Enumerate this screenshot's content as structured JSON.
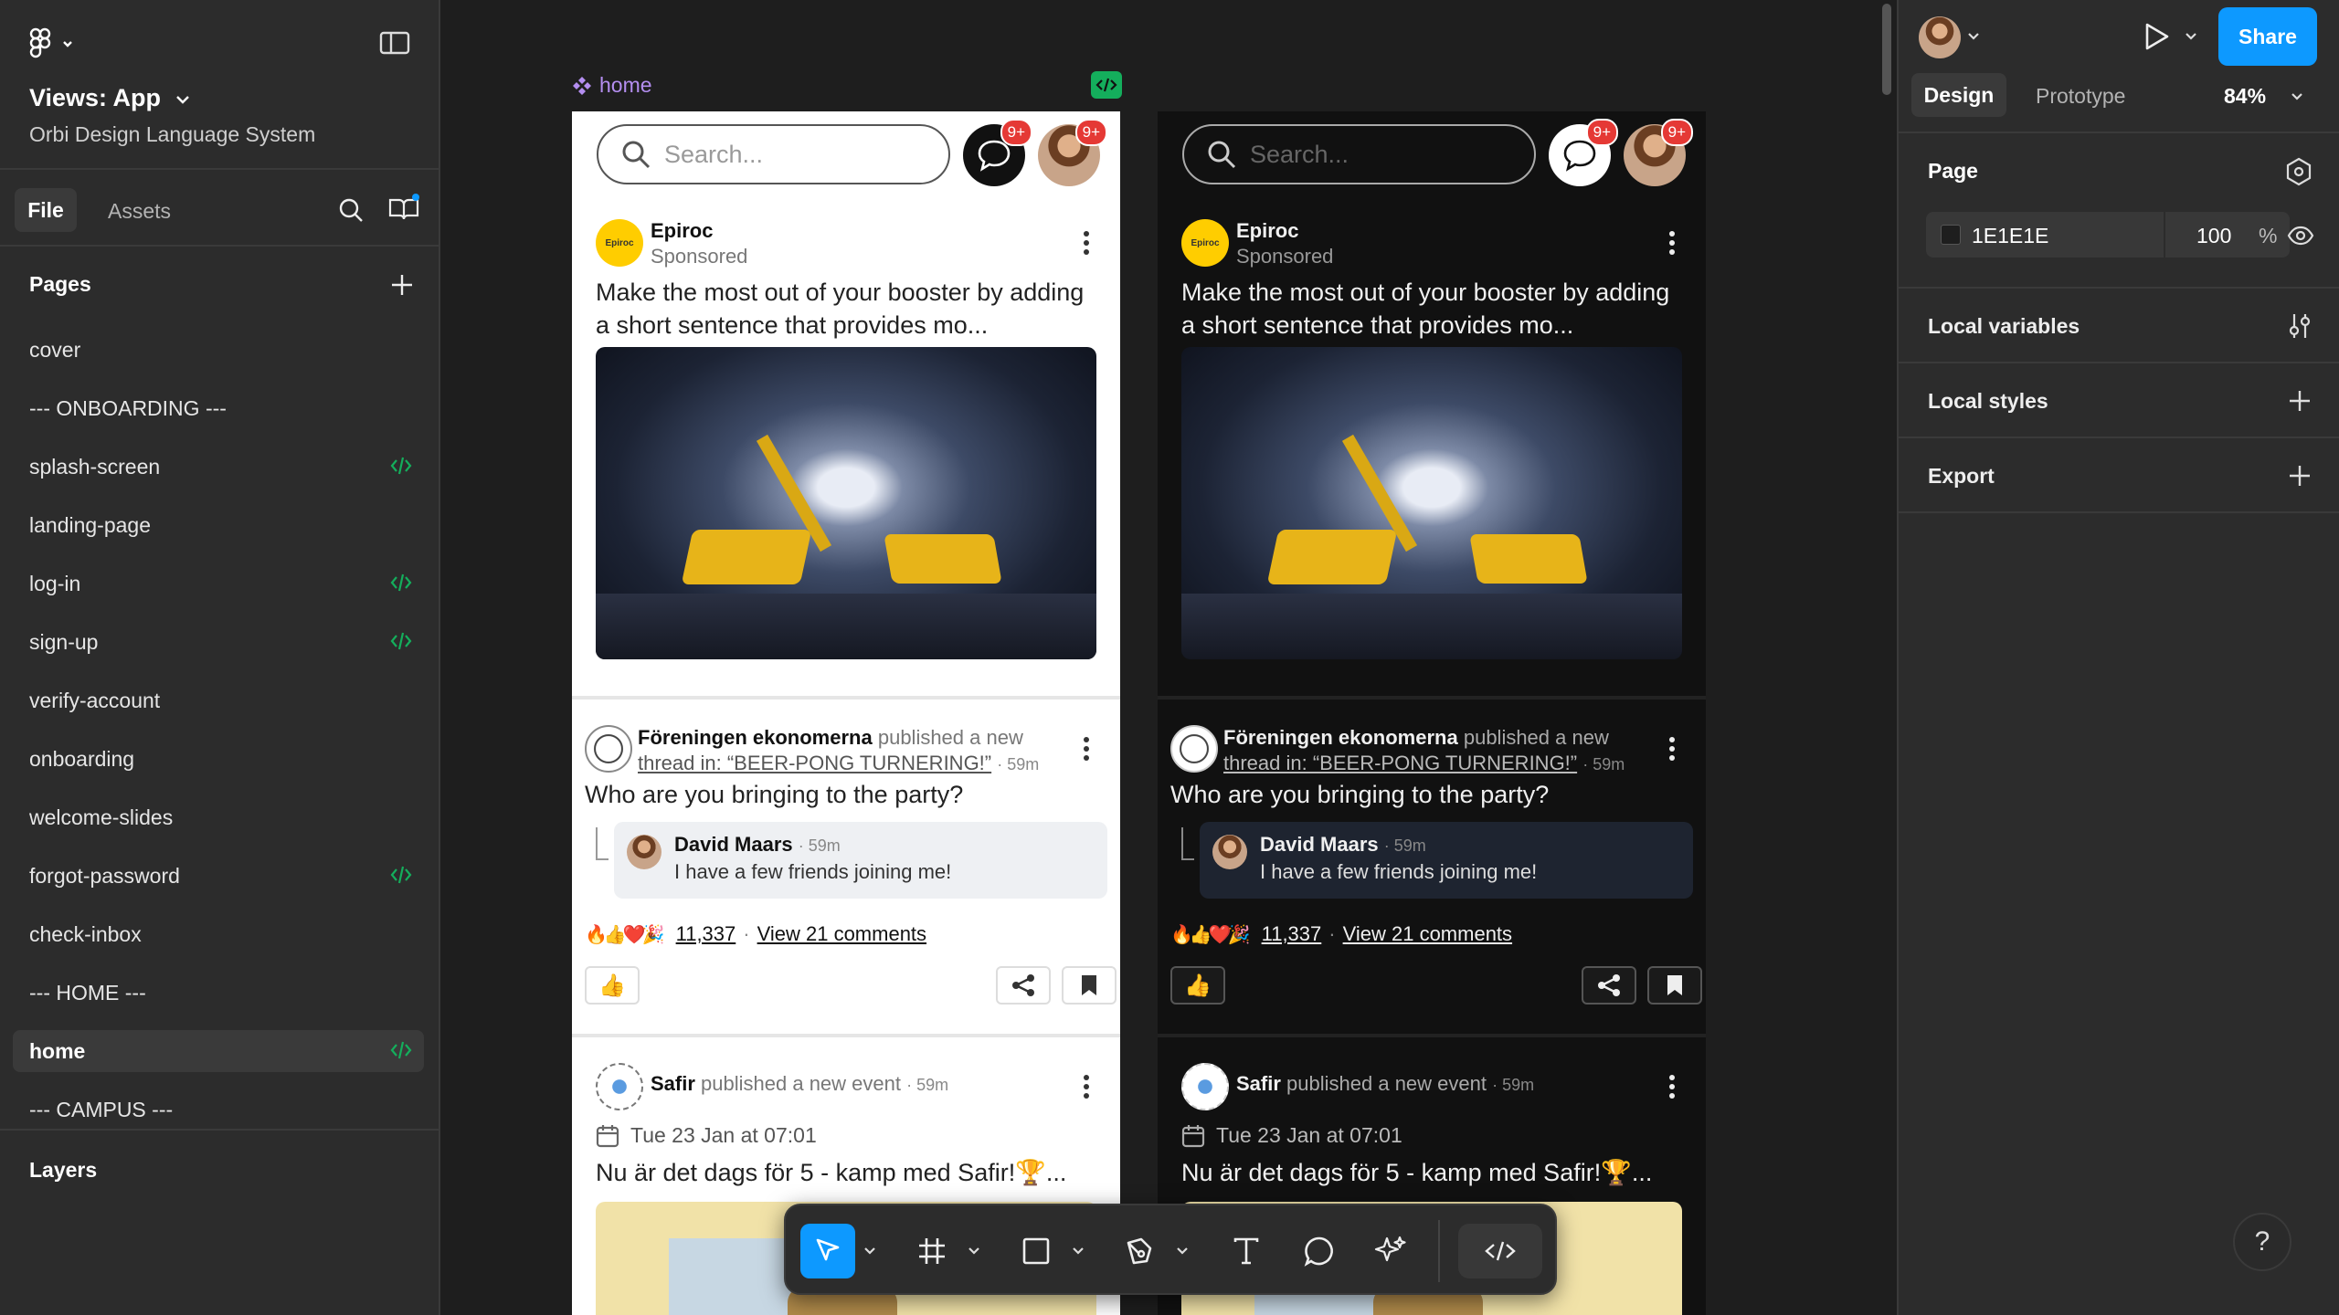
{
  "app": {
    "file_title": "Views: App",
    "team": "Orbi Design Language System"
  },
  "left_panel": {
    "tabs": [
      "File",
      "Assets"
    ],
    "pages_label": "Pages",
    "pages": [
      {
        "label": "cover",
        "code": false
      },
      {
        "label": "--- ONBOARDING ---",
        "code": false
      },
      {
        "label": "splash-screen",
        "code": true
      },
      {
        "label": "landing-page",
        "code": false
      },
      {
        "label": "log-in",
        "code": true
      },
      {
        "label": "sign-up",
        "code": true
      },
      {
        "label": "verify-account",
        "code": false
      },
      {
        "label": "onboarding",
        "code": false
      },
      {
        "label": "welcome-slides",
        "code": false
      },
      {
        "label": "forgot-password",
        "code": true
      },
      {
        "label": "check-inbox",
        "code": false
      },
      {
        "label": "--- HOME ---",
        "code": false
      },
      {
        "label": "home",
        "code": true,
        "selected": true
      },
      {
        "label": "--- CAMPUS ---",
        "code": false
      }
    ],
    "layers_label": "Layers"
  },
  "canvas": {
    "frame_label": "home",
    "search_placeholder": "Search...",
    "badge": "9+",
    "ad": {
      "brand": "Epiroc",
      "logo_text": "Epiroc",
      "sponsored": "Sponsored",
      "text": "Make the most out of your booster by adding a short sentence that provides mo..."
    },
    "thread": {
      "org": "Föreningen ekonomerna",
      "action": "published a new",
      "link": "thread in: “BEER-PONG TURNERING!”",
      "time": "· 59m",
      "question": "Who are you bringing to the party?",
      "reply_name": "David Maars",
      "reply_time": "· 59m",
      "reply_text": "I have a few friends joining me!",
      "reactions_count": "11,337",
      "comments": "View 21 comments",
      "dot": "·"
    },
    "event": {
      "org": "Safir",
      "action": "published a new event",
      "time": "· 59m",
      "date": "Tue 23 Jan at 07:01",
      "title": "Nu är det dags för 5 - kamp med Safir!🏆..."
    }
  },
  "right_panel": {
    "tabs": [
      "Design",
      "Prototype"
    ],
    "zoom": "84%",
    "share": "Share",
    "page_label": "Page",
    "bg_hex": "1E1E1E",
    "bg_color": "#1E1E1E",
    "opacity": "100",
    "percent": "%",
    "sections": [
      "Local variables",
      "Local styles",
      "Export"
    ]
  },
  "help": "?",
  "colors": {
    "accent": "#0d99ff",
    "code_green": "#14ae5c"
  }
}
